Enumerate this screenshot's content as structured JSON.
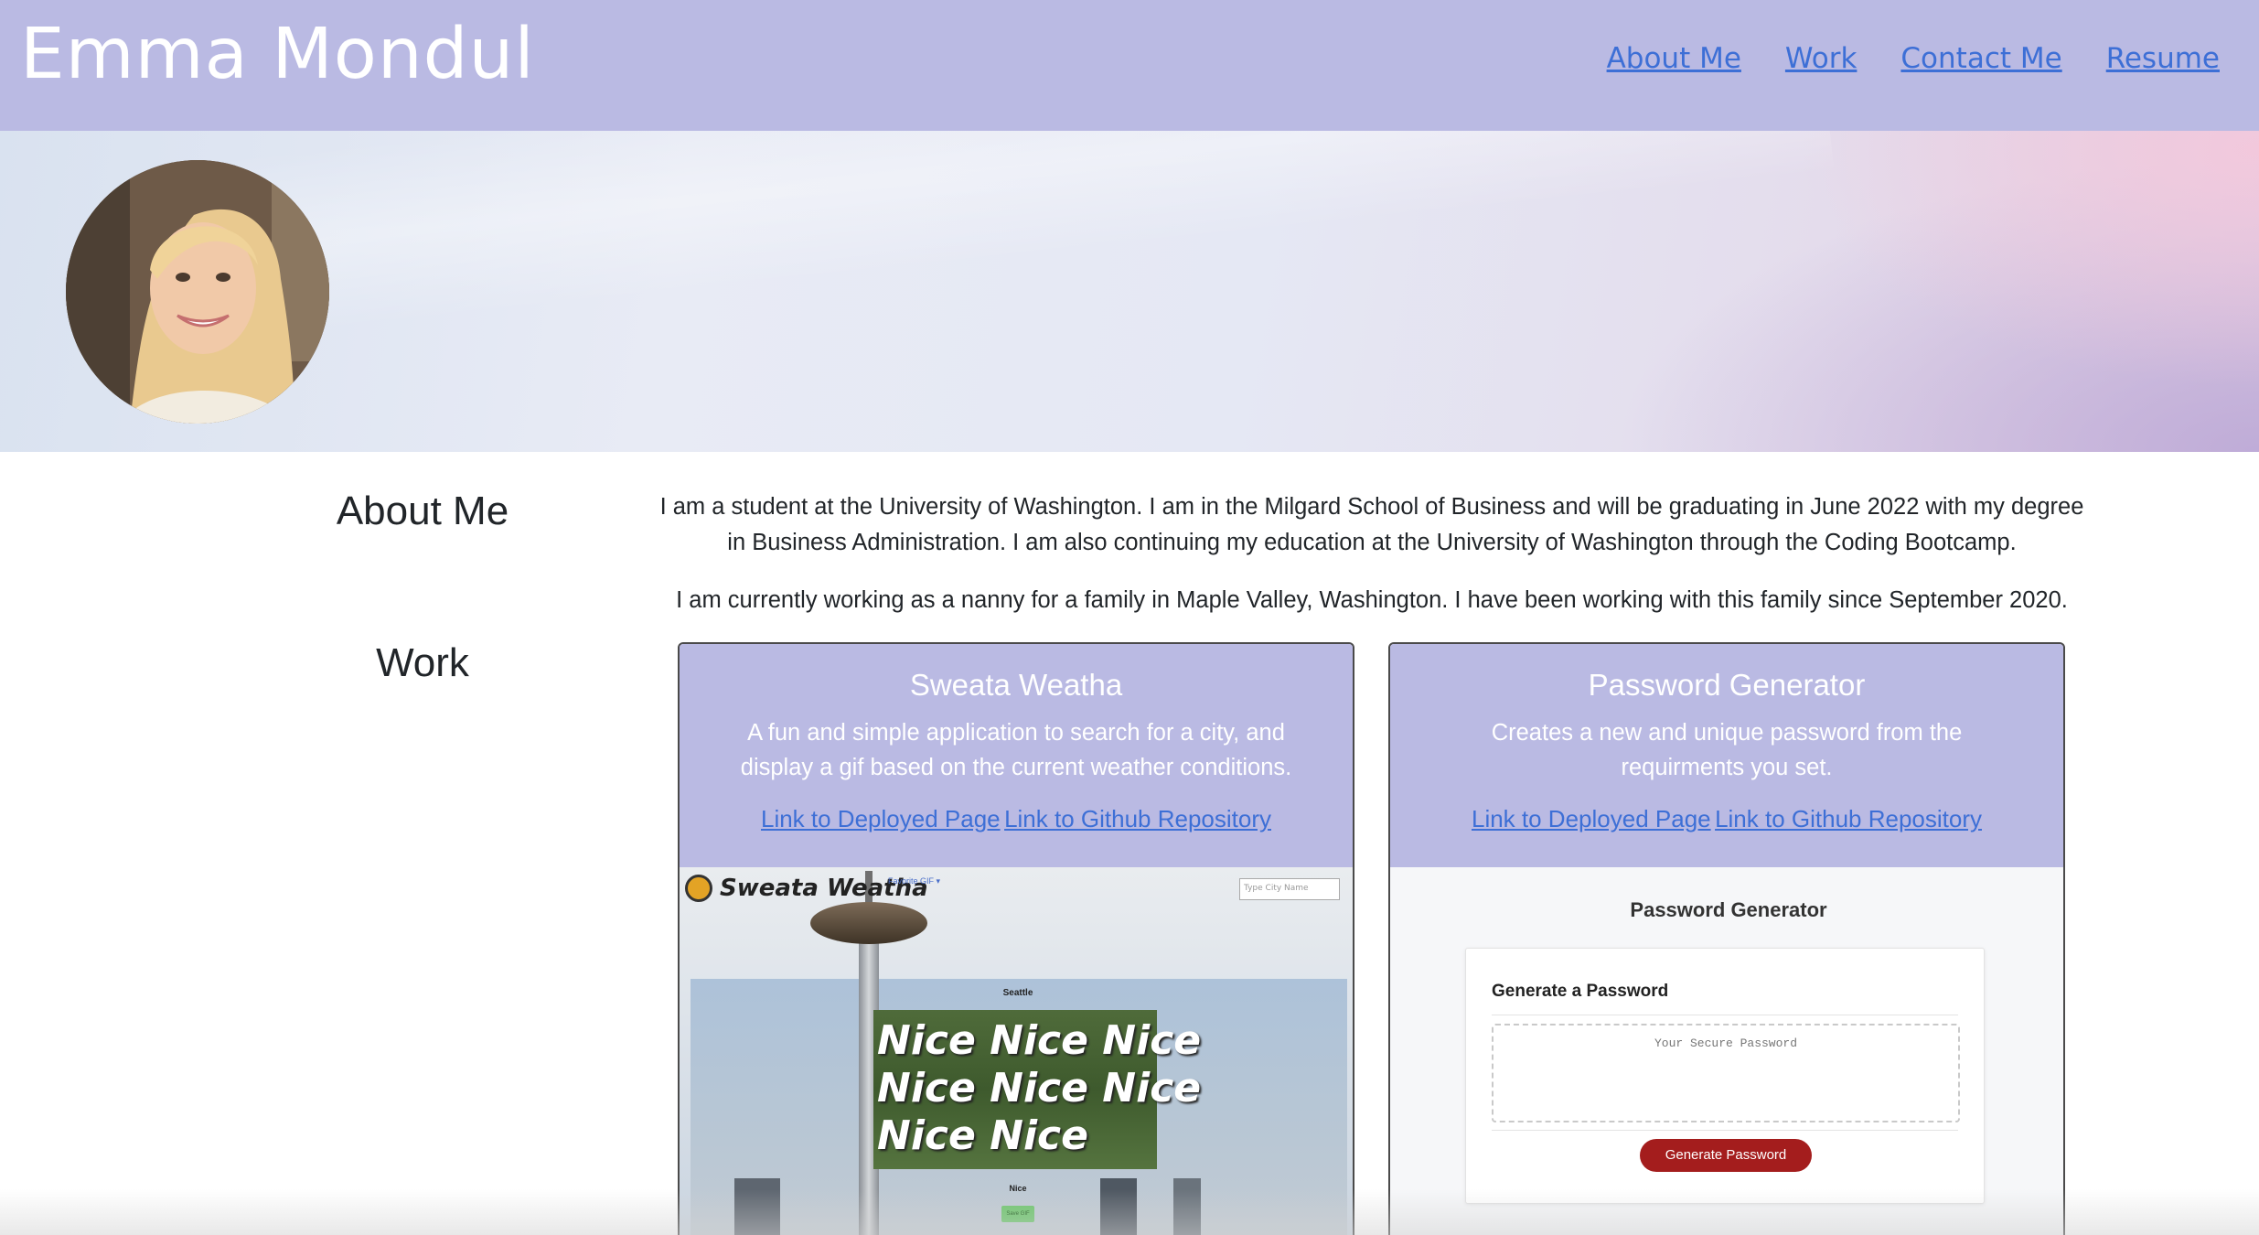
{
  "header": {
    "brand": "Emma Mondul",
    "nav": [
      "About Me",
      "Work",
      "Contact Me",
      "Resume"
    ]
  },
  "about": {
    "title": "About Me",
    "paragraphs": [
      "I am a student at the University of Washington. I am in the Milgard School of Business and will be graduating in June 2022 with my degree in Business Administration. I am also continuing my education at the University of Washington through the Coding Bootcamp.",
      "I am currently working as a nanny for a family in Maple Valley, Washington. I have been working with this family since September 2020."
    ]
  },
  "work": {
    "title": "Work",
    "projects": [
      {
        "title": "Sweata Weatha",
        "description": "A fun and simple application to search for a city, and display a gif based on the current weather conditions.",
        "deployed_link": "Link to Deployed Page",
        "repo_link": "Link to Github Repository",
        "screenshot": {
          "logo": "Sweata Weatha",
          "favorite": "Favorite GIF ▾",
          "search_placeholder": "Type City Name",
          "city": "Seattle",
          "gif_lines": [
            "Nice Nice Nice",
            "Nice Nice Nice",
            "Nice Nice"
          ],
          "condition": "Nice",
          "save": "Save GIF"
        }
      },
      {
        "title": "Password Generator",
        "description": "Creates a new and unique password from the requirments you set.",
        "deployed_link": "Link to Deployed Page",
        "repo_link": "Link to Github Repository",
        "screenshot": {
          "heading": "Password Generator",
          "card_title": "Generate a Password",
          "placeholder": "Your Secure Password",
          "button": "Generate Password"
        }
      }
    ]
  },
  "colors": {
    "navbar": "#babae3",
    "link": "#3d6fd6",
    "card_header": "#babae3",
    "generate_button": "#a41d1d"
  }
}
